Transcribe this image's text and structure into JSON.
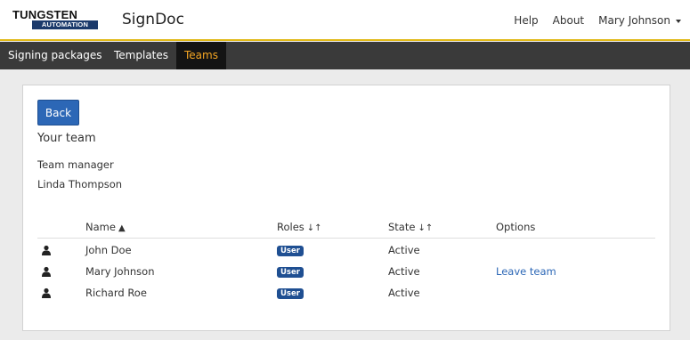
{
  "brand": {
    "logo_top": "TUNGSTEN",
    "logo_bottom": "AUTOMATION",
    "app_title": "SignDoc"
  },
  "top_nav": {
    "help": "Help",
    "about": "About",
    "user": "Mary Johnson"
  },
  "menu": {
    "items": [
      "Signing packages",
      "Templates",
      "Teams"
    ],
    "active": "Teams"
  },
  "team": {
    "back_label": "Back",
    "title": "Your team",
    "manager_label": "Team manager",
    "manager_name": "Linda Thompson",
    "columns": {
      "name": "Name",
      "roles": "Roles",
      "state": "State",
      "options": "Options"
    },
    "sort_icons": {
      "name": "▲",
      "roles": "↓↑",
      "state": "↓↑"
    },
    "members": [
      {
        "name": "John Doe",
        "role": "User",
        "state": "Active",
        "option": ""
      },
      {
        "name": "Mary Johnson",
        "role": "User",
        "state": "Active",
        "option": "Leave team"
      },
      {
        "name": "Richard Roe",
        "role": "User",
        "state": "Active",
        "option": ""
      }
    ]
  },
  "colors": {
    "accent": "#e0b817",
    "menubar": "#3a3a3a",
    "active_tab": "#f5a623",
    "primary": "#2c67b6",
    "badge": "#1f4f92"
  },
  "icons": {
    "member": "user-icon",
    "dropdown": "chevron-down-icon"
  }
}
